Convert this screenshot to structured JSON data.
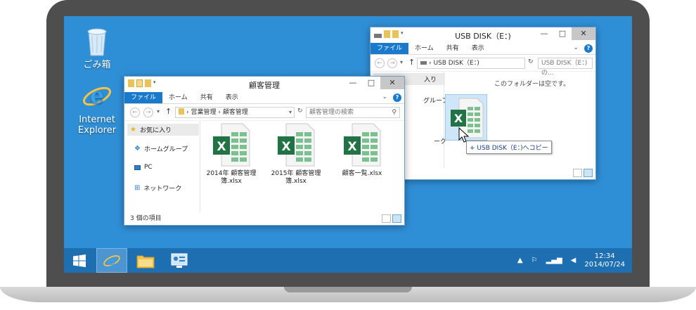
{
  "desktop": {
    "icons": [
      {
        "label": "ごみ箱",
        "icon": "recycle-bin-icon"
      },
      {
        "label": "Internet Explorer",
        "icon": "internet-explorer-icon"
      }
    ]
  },
  "window_usb": {
    "title": "USB DISK（E：)",
    "ribbon": {
      "file": "ファイル",
      "home": "ホーム",
      "share": "共有",
      "view": "表示"
    },
    "address": "USB DISK（E：)",
    "search_placeholder": "USB DISK（E：)の...",
    "empty_message": "このフォルダーは空です。",
    "nav": {
      "favorites_partial": "入り",
      "homegroup_partial": "グループ",
      "network_partial": "ーク"
    },
    "tooltip": "+ USB DISK（E：)へコピー"
  },
  "window_customer": {
    "title": "顧客管理",
    "ribbon": {
      "file": "ファイル",
      "home": "ホーム",
      "share": "共有",
      "view": "表示"
    },
    "breadcrumb": [
      "営業管理",
      "顧客管理"
    ],
    "search_placeholder": "顧客管理の検索",
    "nav": {
      "favorites": "お気に入り",
      "homegroup": "ホームグループ",
      "pc": "PC",
      "network": "ネットワーク"
    },
    "files": [
      {
        "name": "2014年 顧客管理簿.xlsx"
      },
      {
        "name": "2015年 顧客管理簿.xlsx"
      },
      {
        "name": "顧客一覧.xlsx"
      }
    ],
    "status": "3 個の項目"
  },
  "taskbar": {
    "time": "12:34",
    "date": "2014/07/24"
  },
  "colors": {
    "desktop": "#2f8fd6",
    "taskbar": "#1d6fb2",
    "excel_green": "#217346",
    "ribbon_file": "#1979ca"
  }
}
